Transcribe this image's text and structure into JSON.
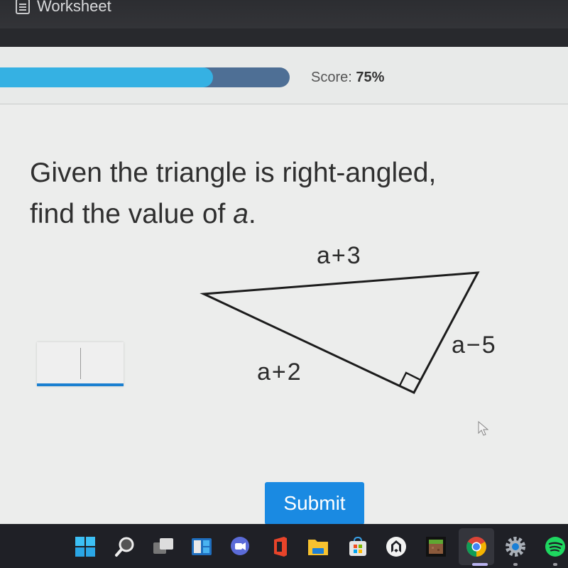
{
  "app": {
    "title": "Worksheet",
    "title_icon": "document-icon"
  },
  "progress": {
    "percent": 75,
    "score_label": "Score:",
    "score_value": "75%"
  },
  "question": {
    "line1": "Given the triangle is right-angled,",
    "line2_prefix": "find the value of ",
    "line2_var": "a",
    "line2_suffix": "."
  },
  "triangle": {
    "labels": {
      "top": "a+3",
      "left": "a+2",
      "right": "a−5"
    },
    "right_angle": true
  },
  "answer": {
    "value": "",
    "placeholder": ""
  },
  "actions": {
    "submit_label": "Submit"
  },
  "colors": {
    "accent": "#1a8ae2",
    "progress_fill": "#35b1e3",
    "progress_track": "#4e6f95"
  },
  "taskbar": {
    "items": [
      {
        "name": "start",
        "icon": "windows-start-icon"
      },
      {
        "name": "search",
        "icon": "search-icon"
      },
      {
        "name": "task-view",
        "icon": "task-view-icon"
      },
      {
        "name": "widgets",
        "icon": "widgets-icon"
      },
      {
        "name": "teams-chat",
        "icon": "chat-icon"
      },
      {
        "name": "office",
        "icon": "office-icon"
      },
      {
        "name": "file-explorer",
        "icon": "folder-icon"
      },
      {
        "name": "store",
        "icon": "store-icon"
      },
      {
        "name": "app",
        "icon": "app-icon"
      },
      {
        "name": "minecraft",
        "icon": "minecraft-icon"
      },
      {
        "name": "chrome",
        "icon": "chrome-icon",
        "active": true
      },
      {
        "name": "settings",
        "icon": "settings-icon"
      },
      {
        "name": "spotify",
        "icon": "spotify-icon"
      }
    ]
  }
}
